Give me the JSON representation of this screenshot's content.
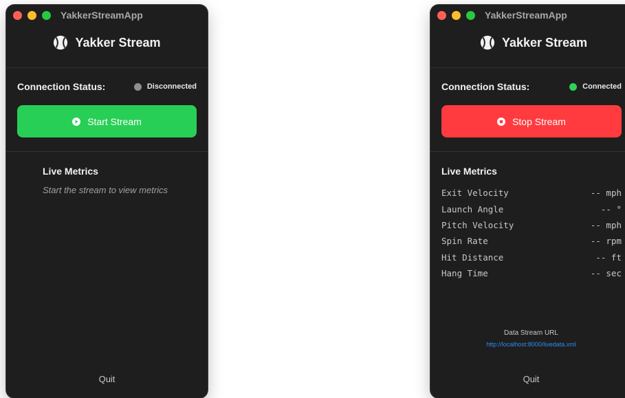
{
  "windows": {
    "left": {
      "title": "YakkerStreamApp",
      "app_name": "Yakker Stream",
      "status_label": "Connection Status:",
      "status_text": "Disconnected",
      "button_label": "Start Stream",
      "metrics_title": "Live Metrics",
      "hint": "Start the stream to view metrics",
      "quit_label": "Quit"
    },
    "right": {
      "title": "YakkerStreamApp",
      "app_name": "Yakker Stream",
      "status_label": "Connection Status:",
      "status_text": "Connected",
      "button_label": "Stop Stream",
      "metrics_title": "Live Metrics",
      "metrics": [
        {
          "name": "Exit Velocity",
          "value": "-- mph"
        },
        {
          "name": "Launch Angle",
          "value": "-- °"
        },
        {
          "name": "Pitch Velocity",
          "value": "-- mph"
        },
        {
          "name": "Spin Rate",
          "value": "-- rpm"
        },
        {
          "name": "Hit Distance",
          "value": "-- ft"
        },
        {
          "name": "Hang Time",
          "value": "-- sec"
        }
      ],
      "url_label": "Data Stream URL",
      "url": "http://localhost:8000/livedata.xml",
      "quit_label": "Quit"
    }
  },
  "icons": {
    "app": "baseball-icon",
    "start": "play-circle-icon",
    "stop": "stop-circle-icon"
  },
  "colors": {
    "window_bg": "#1e1e1e",
    "start_green": "#28cf56",
    "stop_red": "#ff3b3f",
    "status_grey": "#8e8e93",
    "status_green": "#30d158",
    "link_blue": "#2c8cf0"
  }
}
